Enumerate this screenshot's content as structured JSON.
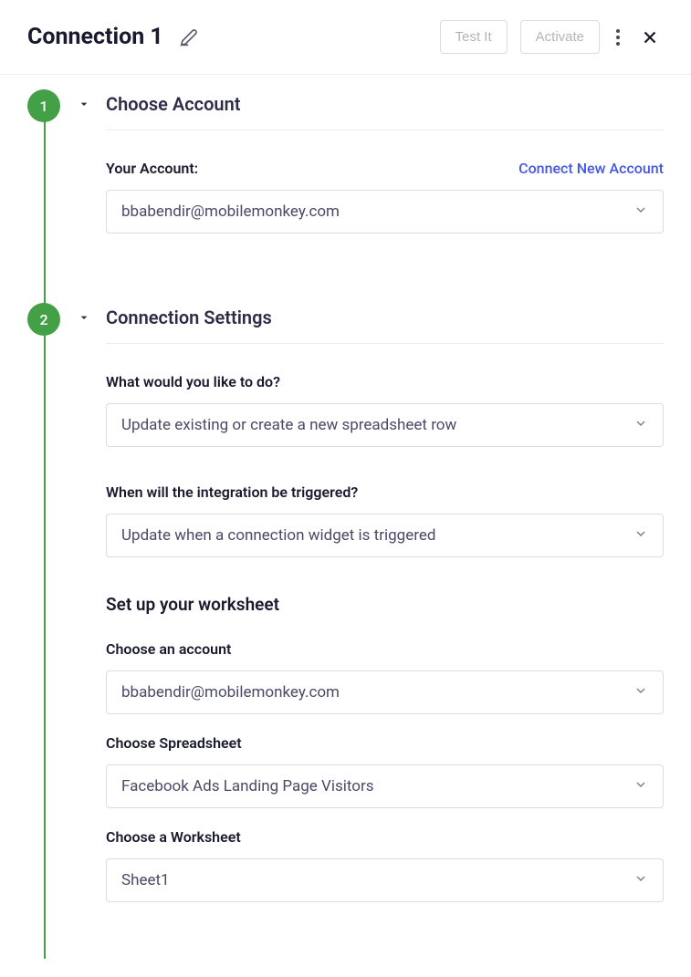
{
  "header": {
    "title": "Connection 1",
    "test_button": "Test It",
    "activate_button": "Activate"
  },
  "steps": [
    {
      "number": "1",
      "title": "Choose Account",
      "account": {
        "label": "Your Account:",
        "connect_link": "Connect New Account",
        "value": "bbabendir@mobilemonkey.com"
      }
    },
    {
      "number": "2",
      "title": "Connection Settings",
      "action": {
        "label": "What would you like to do?",
        "value": "Update existing or create a new spreadsheet row"
      },
      "trigger": {
        "label": "When will the integration be triggered?",
        "value": "Update when a connection widget is triggered"
      },
      "worksheet_setup": {
        "title": "Set up your worksheet",
        "account": {
          "label": "Choose an account",
          "value": "bbabendir@mobilemonkey.com"
        },
        "spreadsheet": {
          "label": "Choose Spreadsheet",
          "value": "Facebook Ads Landing Page Visitors"
        },
        "worksheet": {
          "label": "Choose a Worksheet",
          "value": "Sheet1"
        }
      }
    }
  ]
}
